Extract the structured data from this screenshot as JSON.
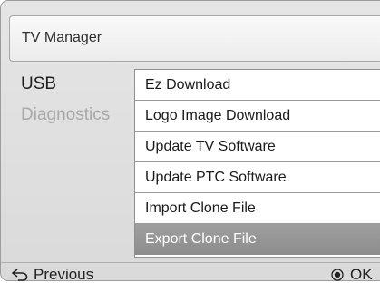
{
  "window": {
    "title": "TV Manager"
  },
  "categories": [
    {
      "label": "USB",
      "state": "active"
    },
    {
      "label": "Diagnostics",
      "state": "inactive"
    }
  ],
  "submenu": {
    "items": [
      {
        "label": "Ez Download",
        "selected": false
      },
      {
        "label": "Logo Image Download",
        "selected": false
      },
      {
        "label": "Update TV Software",
        "selected": false
      },
      {
        "label": "Update PTC Software",
        "selected": false
      },
      {
        "label": "Import Clone File",
        "selected": false
      },
      {
        "label": "Export Clone File",
        "selected": true
      }
    ]
  },
  "footer": {
    "previous_label": "Previous",
    "previous_icon": "return-arrow-icon",
    "ok_label": "OK",
    "ok_icon": "ok-button-icon"
  },
  "colors": {
    "selected_background": "#959595",
    "selected_text": "#ffffff",
    "inactive_text": "#a9a9a9"
  }
}
